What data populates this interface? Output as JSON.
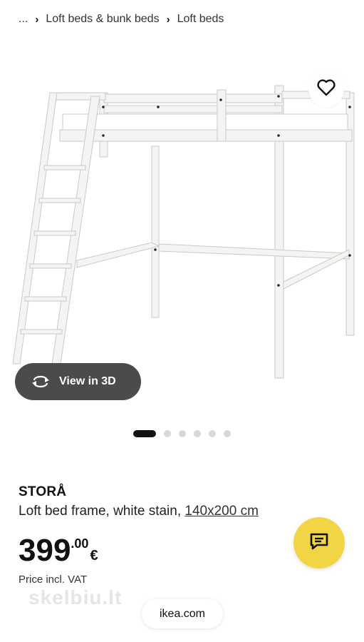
{
  "breadcrumb": {
    "ellipsis": "...",
    "items": [
      "Loft beds & bunk beds",
      "Loft beds"
    ]
  },
  "image": {
    "icon": "loft-bed-product-photo"
  },
  "favorite": {
    "icon": "heart-icon"
  },
  "view3d": {
    "label": "View in 3D",
    "icon": "rotate-3d-icon"
  },
  "carousel": {
    "total": 6,
    "active_index": 0
  },
  "product": {
    "name": "STORÅ",
    "description": "Loft bed frame, white stain,",
    "size": "140x200 cm",
    "price_integer": "399",
    "price_decimal": ".00",
    "currency": "€",
    "vat_note": "Price incl. VAT"
  },
  "chat": {
    "icon": "chat-icon",
    "color": "#f2d544"
  },
  "watermark": {
    "text": "skelbiu.lt"
  },
  "site": {
    "label": "ikea.com"
  }
}
